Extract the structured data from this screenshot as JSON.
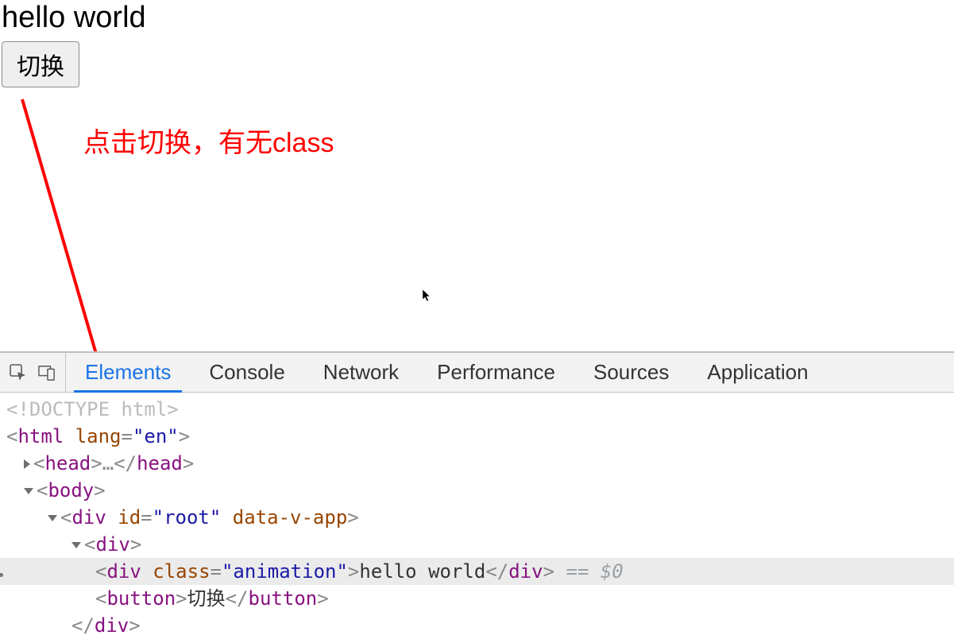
{
  "page": {
    "helloText": "hello world",
    "buttonLabel": "切换"
  },
  "annotation": {
    "text": "点击切换，有无class"
  },
  "devtools": {
    "tabs": {
      "elements": "Elements",
      "console": "Console",
      "network": "Network",
      "performance": "Performance",
      "sources": "Sources",
      "application": "Application"
    },
    "code": {
      "doctype": "<!DOCTYPE html>",
      "htmlOpen_tag": "html",
      "htmlOpen_attrName": "lang",
      "htmlOpen_attrVal": "\"en\"",
      "headOpen": "head",
      "headEllipsis": "…",
      "headClose": "head",
      "body": "body",
      "div": "div",
      "idAttr": "id",
      "idVal": "\"root\"",
      "dataVApp": "data-v-app",
      "classAttr": "class",
      "classVal": "\"animation\"",
      "helloContent": "hello world",
      "button": "button",
      "buttonContent": "切换",
      "eqSel": " == $0"
    }
  }
}
